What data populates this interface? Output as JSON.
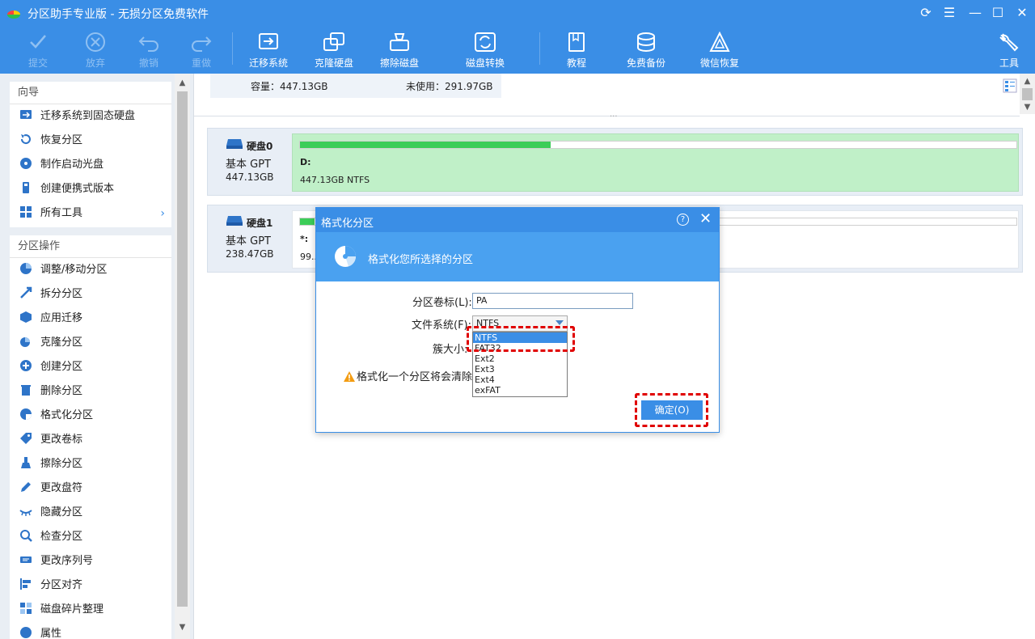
{
  "app": {
    "title": "分区助手专业版 - 无损分区免费软件"
  },
  "toolbar": {
    "items": [
      {
        "label": "提交",
        "icon": "check-icon",
        "enabled": false
      },
      {
        "label": "放弃",
        "icon": "cancel-icon",
        "enabled": false
      },
      {
        "label": "撤销",
        "icon": "undo-icon",
        "enabled": false
      },
      {
        "label": "重做",
        "icon": "redo-icon",
        "enabled": false
      },
      {
        "label": "迁移系统",
        "icon": "migrate-os-icon",
        "enabled": true
      },
      {
        "label": "克隆硬盘",
        "icon": "clone-disk-icon",
        "enabled": true
      },
      {
        "label": "擦除磁盘",
        "icon": "wipe-disk-icon",
        "enabled": true
      },
      {
        "label": "磁盘转换",
        "icon": "convert-disk-icon",
        "enabled": true
      },
      {
        "label": "教程",
        "icon": "book-icon",
        "enabled": true
      },
      {
        "label": "免费备份",
        "icon": "backup-icon",
        "enabled": true
      },
      {
        "label": "微信恢复",
        "icon": "wechat-recovery-icon",
        "enabled": true
      },
      {
        "label": "工具",
        "icon": "wrench-icon",
        "enabled": true
      }
    ]
  },
  "sidebar": {
    "wizard": {
      "header": "向导",
      "items": [
        "迁移系统到固态硬盘",
        "恢复分区",
        "制作启动光盘",
        "创建便携式版本",
        "所有工具"
      ]
    },
    "operations": {
      "header": "分区操作",
      "items": [
        "调整/移动分区",
        "拆分分区",
        "应用迁移",
        "克隆分区",
        "创建分区",
        "删除分区",
        "格式化分区",
        "更改卷标",
        "擦除分区",
        "更改盘符",
        "隐藏分区",
        "检查分区",
        "更改序列号",
        "分区对齐",
        "磁盘碎片整理",
        "属性"
      ]
    }
  },
  "summary": {
    "capacity": "容量：447.13GB",
    "unused": "未使用：291.97GB"
  },
  "disks": [
    {
      "name": "硬盘0",
      "type": "基本 GPT",
      "size": "447.13GB",
      "partition": {
        "label": "D:",
        "info": "447.13GB NTFS",
        "used_fraction": 0.35
      }
    },
    {
      "name": "硬盘1",
      "type": "基本 GPT",
      "size": "238.47GB",
      "partition": {
        "label": "*:",
        "info": "99...",
        "used_fraction": 0.02
      }
    }
  ],
  "dialog": {
    "title": "格式化分区",
    "help": "?",
    "banner": "格式化您所选择的分区",
    "volume_label_caption": "分区卷标(L):",
    "volume_label_value": "PA",
    "fs_caption": "文件系统(F):",
    "fs_value": "NTFS",
    "cluster_caption": "簇大小:",
    "warning": "格式化一个分区将会清除这",
    "fs_options": [
      "NTFS",
      "FAT32",
      "Ext2",
      "Ext3",
      "Ext4",
      "exFAT"
    ],
    "ok": "确定(O)"
  },
  "colors": {
    "accent": "#3a8ee6",
    "partition_used": "#3ccd58",
    "highlight": "#e00000"
  }
}
